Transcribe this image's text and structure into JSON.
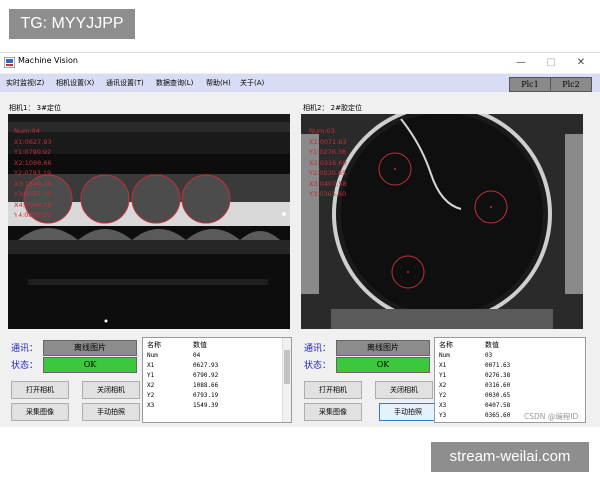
{
  "overlay_tags": {
    "top": "TG: MYYJJPP",
    "bottom": "stream-weilai.com"
  },
  "watermark": "CSDN @编程ID",
  "window": {
    "title": "Machine Vision",
    "controls": {
      "minimize": "—",
      "maximize": "□",
      "close": "✕"
    }
  },
  "menu": {
    "items": [
      "实时监视(Z)",
      "相机设置(X)",
      "通讯设置(T)",
      "数据查询(L)",
      "帮助(H)",
      "关于(A)"
    ],
    "plc1": "Plc1",
    "plc2": "Plc2"
  },
  "cameras": [
    {
      "label": "相机1： 3#定位",
      "overlay": [
        "Num:04",
        "X1:0627.93",
        "Y1:0790.92",
        "X2:1088.66",
        "Y2:0793.19",
        "X3:1549.39",
        "Y3:0795.39",
        "X4:2008.19",
        "Y4:0800.59"
      ],
      "comm_label": "通讯：",
      "comm_value": "离线图片",
      "status_label": "状态：",
      "status_value": "OK",
      "buttons": {
        "open": "打开相机",
        "close": "关闭相机",
        "capture": "采集图像",
        "manual": "手动拍照"
      },
      "table": {
        "headers": [
          "名称",
          "数值"
        ],
        "rows": [
          [
            "Num",
            "04"
          ],
          [
            "X1",
            "0627.93"
          ],
          [
            "Y1",
            "0790.92"
          ],
          [
            "X2",
            "1088.66"
          ],
          [
            "Y2",
            "0793.19"
          ],
          [
            "X3",
            "1549.39"
          ]
        ]
      }
    },
    {
      "label": "相机2： 2#胶定位",
      "overlay": [
        "Num:03",
        "X1:0071.63",
        "Y1:0276.38",
        "X2:0316.60",
        "Y2:0030.65",
        "X3:0407.58",
        "Y3:0365.60"
      ],
      "comm_label": "通讯：",
      "comm_value": "离线图片",
      "status_label": "状态：",
      "status_value": "OK",
      "buttons": {
        "open": "打开相机",
        "close": "关闭相机",
        "capture": "采集图像",
        "manual": "手动拍照"
      },
      "table": {
        "headers": [
          "名称",
          "数值"
        ],
        "rows": [
          [
            "Num",
            "03"
          ],
          [
            "X1",
            "0071.63"
          ],
          [
            "Y1",
            "0276.38"
          ],
          [
            "X2",
            "0316.60"
          ],
          [
            "Y2",
            "0030.65"
          ],
          [
            "X3",
            "0407.58"
          ],
          [
            "Y3",
            "0365.60"
          ]
        ]
      }
    }
  ],
  "colors": {
    "menubar": "#d9dcf5",
    "status_ok": "#3cc83c",
    "overlay_red": "#c0303a",
    "label_blue": "#2323c8"
  }
}
